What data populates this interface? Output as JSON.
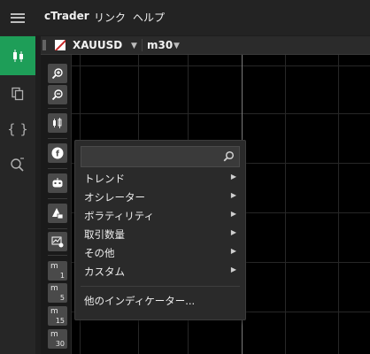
{
  "menu": {
    "app_name": "cTrader",
    "links": "リンク",
    "help": "ヘルプ"
  },
  "chart": {
    "symbol": "XAUUSD",
    "timeframe": "m30",
    "caret": "▼"
  },
  "toolbar": {
    "tf_buttons": [
      {
        "m": "m",
        "n": "1"
      },
      {
        "m": "m",
        "n": "5"
      },
      {
        "m": "m",
        "n": "15"
      },
      {
        "m": "m",
        "n": "30"
      }
    ]
  },
  "indicator_menu": {
    "search_value": "",
    "items": [
      {
        "label": "トレンド",
        "arrow": "▶"
      },
      {
        "label": "オシレーター",
        "arrow": "▶"
      },
      {
        "label": "ボラティリティ",
        "arrow": "▶"
      },
      {
        "label": "取引数量",
        "arrow": "▶"
      },
      {
        "label": "その他",
        "arrow": "▶"
      },
      {
        "label": "カスタム",
        "arrow": "▶"
      }
    ],
    "more": "他のインディケーター..."
  },
  "colors": {
    "accent": "#1e9e58",
    "background": "#000000"
  }
}
